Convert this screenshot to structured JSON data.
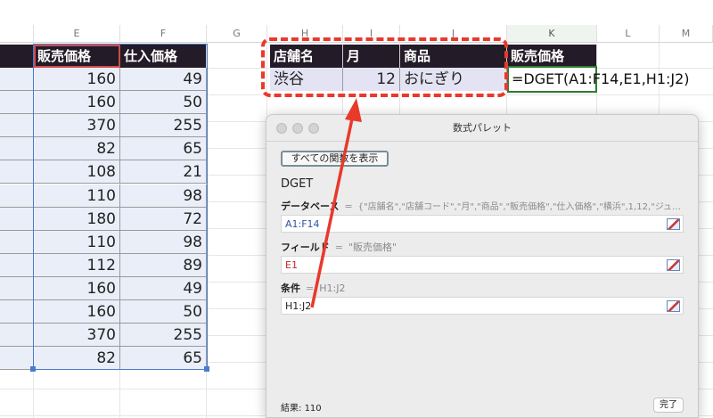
{
  "sheet": {
    "columns": [
      "E",
      "F",
      "G",
      "H",
      "I",
      "J",
      "K",
      "L",
      "M"
    ],
    "data_headers": [
      "販売価格",
      "仕入価格"
    ],
    "rows": [
      [
        "160",
        "49"
      ],
      [
        "160",
        "50"
      ],
      [
        "370",
        "255"
      ],
      [
        "82",
        "65"
      ],
      [
        "108",
        "21"
      ],
      [
        "110",
        "98"
      ],
      [
        "180",
        "72"
      ],
      [
        "110",
        "98"
      ],
      [
        "112",
        "89"
      ],
      [
        "160",
        "49"
      ],
      [
        "160",
        "50"
      ],
      [
        "370",
        "255"
      ],
      [
        "82",
        "65"
      ]
    ],
    "criteria_headers": [
      "店舗名",
      "月",
      "商品"
    ],
    "criteria_values": [
      "渋谷",
      "12",
      "おにぎり"
    ],
    "result_header": "販売価格",
    "formula": "=DGET(A1:F14,E1,H1:J2)"
  },
  "colors": {
    "header_bg": "#231b27",
    "annotation": "#e8392b",
    "selection": "#4a7bd0"
  },
  "palette": {
    "title": "数式パレット",
    "show_all_button": "すべての関数を表示",
    "function_name": "DGET",
    "args": [
      {
        "label": "データベース",
        "eq": "=",
        "preview": "{\"店舗名\",\"店舗コード\",\"月\",\"商品\",\"販売価格\",\"仕入価格\",\"横浜\",1,12,\"ジュ…",
        "value": "A1:F14",
        "value_color": "#2b55a6"
      },
      {
        "label": "フィールド",
        "eq": "=",
        "preview": "\"販売価格\"",
        "value": "E1",
        "value_color": "#c42a2a"
      },
      {
        "label": "条件",
        "eq": "=",
        "preview": "H1:J2",
        "value": "H1:J2",
        "value_color": "#222222"
      }
    ],
    "result_label": "結果:",
    "result_value": "110",
    "done_button": "完了"
  }
}
